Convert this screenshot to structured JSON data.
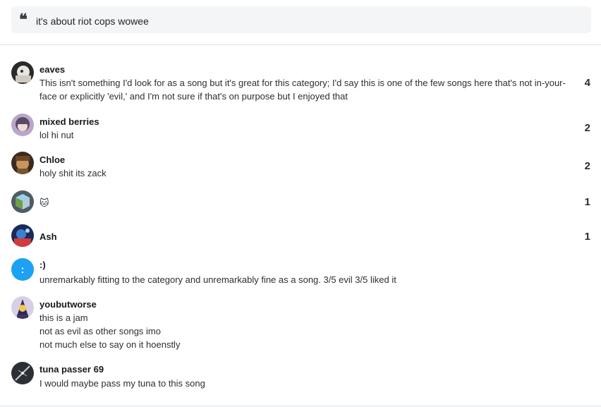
{
  "quote": {
    "icon": "quote-icon",
    "text": "it's about riot cops wowee"
  },
  "comments": [
    {
      "username": "eaves",
      "avatar": "avatar-eaves",
      "lines": [
        "This isn't something I'd look for as a song but it's great for this category; I'd say this is one of the few songs here that's not in-your-",
        "face or explicitly 'evil,' and I'm not sure if that's on purpose but I enjoyed that"
      ],
      "votes": "4"
    },
    {
      "username": "mixed berries",
      "avatar": "avatar-mixed-berries",
      "lines": [
        "lol hi nut"
      ],
      "votes": "2"
    },
    {
      "username": "Chloe",
      "avatar": "avatar-chloe",
      "lines": [
        "holy shit its zack"
      ],
      "votes": "2"
    },
    {
      "username": "",
      "avatar": "avatar-cube",
      "lines": [
        "🐱"
      ],
      "votes": "1"
    },
    {
      "username": "Ash",
      "avatar": "avatar-ash",
      "lines": [],
      "votes": "1"
    },
    {
      "username": ":)",
      "avatar": "avatar-smiley",
      "avatar_glyph": ":",
      "lines": [
        "unremarkably fitting to the category and unremarkably fine as a song. 3/5 evil 3/5 liked it"
      ],
      "votes": ""
    },
    {
      "username": "youbutworse",
      "avatar": "avatar-youbutworse",
      "lines": [
        "this is a jam",
        "not as evil as other songs imo",
        "not much else to say on it hoenstly"
      ],
      "votes": ""
    },
    {
      "username": "tuna passer 69",
      "avatar": "avatar-tuna-passer",
      "lines": [
        "I would maybe pass my tuna to this song"
      ],
      "votes": ""
    }
  ],
  "colors": {
    "smiley_avatar": "#1da1f2",
    "quote_bg": "#f4f5f6",
    "divider": "#dcdfe3"
  }
}
